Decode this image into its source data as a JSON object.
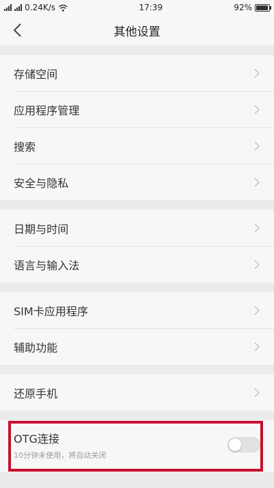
{
  "status_bar": {
    "speed": "0.24K/s",
    "time": "17:39",
    "battery": "92%",
    "battery_level": 0.92
  },
  "header": {
    "title": "其他设置"
  },
  "groups": [
    {
      "items": [
        {
          "label": "存储空间"
        },
        {
          "label": "应用程序管理"
        },
        {
          "label": "搜索"
        },
        {
          "label": "安全与隐私"
        }
      ]
    },
    {
      "items": [
        {
          "label": "日期与时间"
        },
        {
          "label": "语言与输入法"
        }
      ]
    },
    {
      "items": [
        {
          "label": "SIM卡应用程序"
        },
        {
          "label": "辅助功能"
        }
      ]
    },
    {
      "items": [
        {
          "label": "还原手机"
        }
      ]
    }
  ],
  "otg": {
    "label": "OTG连接",
    "description": "10分钟未使用，将自动关闭",
    "enabled": false
  },
  "colors": {
    "highlight": "#c8102e",
    "background": "#f7f7f7",
    "divider_band": "#ebebeb"
  }
}
